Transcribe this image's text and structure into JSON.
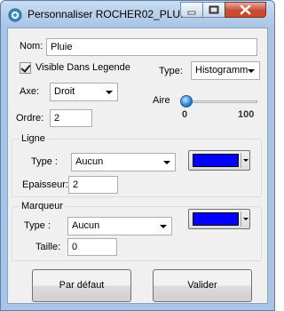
{
  "window": {
    "title": "Personnaliser ROCHER02_PLU..."
  },
  "form": {
    "nom_label": "Nom:",
    "nom_value": "Pluie",
    "visible_label": "Visible Dans Legende",
    "visible_checked": true,
    "type_label": "Type:",
    "type_value": "Histogramm",
    "axe_label": "Axe:",
    "axe_value": "Droit",
    "aire_label": "Aire",
    "aire_min": "0",
    "aire_max": "100",
    "aire_value": 0,
    "ordre_label": "Ordre:",
    "ordre_value": "2"
  },
  "ligne": {
    "title": "Ligne",
    "type_label": "Type :",
    "type_value": "Aucun",
    "color": "#0000ff",
    "epaisseur_label": "Epaisseur:",
    "epaisseur_value": "2"
  },
  "marqueur": {
    "title": "Marqueur",
    "type_label": "Type :",
    "type_value": "Aucun",
    "color": "#0000ff",
    "taille_label": "Taille:",
    "taille_value": "0"
  },
  "buttons": {
    "default_label": "Par défaut",
    "validate_label": "Valider"
  }
}
